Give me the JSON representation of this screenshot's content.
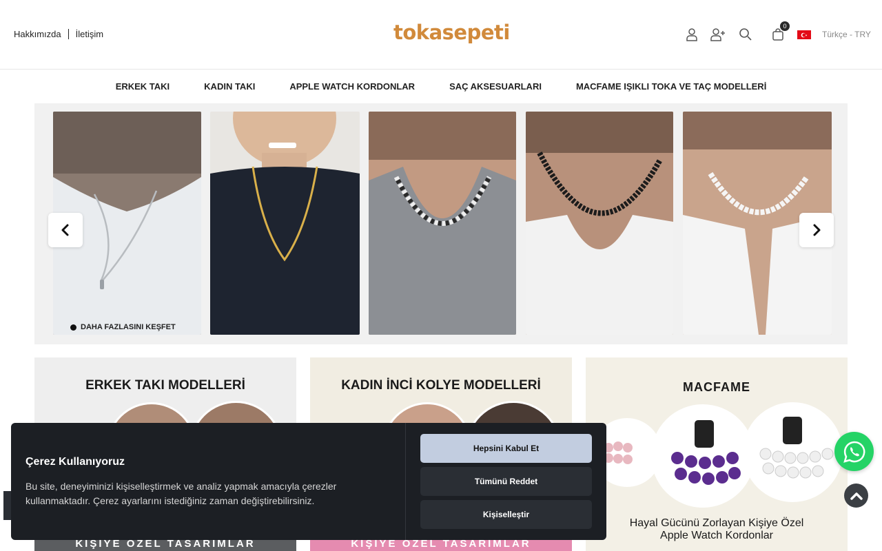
{
  "header": {
    "links": [
      "Hakkımızda",
      "İletişim"
    ],
    "logo": "tokasepeti",
    "cart_count": "0",
    "language": "Türkçe - TRY",
    "icons": [
      "user-icon",
      "user-plus-icon",
      "search-icon",
      "shopping-bag-icon",
      "turkey-flag-icon"
    ]
  },
  "nav": {
    "items": [
      "ERKEK TAKI",
      "KADIN TAKI",
      "APPLE WATCH KORDONLAR",
      "SAÇ AKSESUARLARI",
      "MACFAME IŞIKLI TOKA ve TAÇ MODELLERİ"
    ]
  },
  "slider": {
    "explore_label": "DAHA FAZLASINI KEŞFET"
  },
  "cards": [
    {
      "title": "ERKEK TAKI MODELLERİ",
      "banner": "KİŞİYE ÖZEL TASARIMLAR",
      "bg": "#eeeeee",
      "banner_color": "#5b5d60"
    },
    {
      "title": "KADIN İNCİ KOLYE MODELLERİ",
      "banner": "KİŞİYE ÖZEL TASARIMLAR",
      "bg": "#f1ede2",
      "banner_color": "#e58bb0"
    },
    {
      "title": "MACFAME",
      "subtitle_line1": "Hayal Gücünü Zorlayan Kişiye Özel",
      "subtitle_line2": "Apple Watch Kordonlar",
      "bg": "#f3f0e6"
    }
  ],
  "cookie": {
    "title": "Çerez Kullanıyoruz",
    "text": "Bu site, deneyiminizi kişiselleştirmek ve analiz yapmak amacıyla çerezler kullanmaktadır. Çerez ayarlarını istediğiniz zaman değiştirebilirsiniz.",
    "accept": "Hepsini Kabul Et",
    "reject": "Tümünü Reddet",
    "customize": "Kişiselleştir"
  },
  "colors": {
    "logo": "#d18a3b",
    "whatsapp": "#25d366",
    "cookie_bg": "#1c1f24",
    "accept_btn": "#c2cde0"
  }
}
